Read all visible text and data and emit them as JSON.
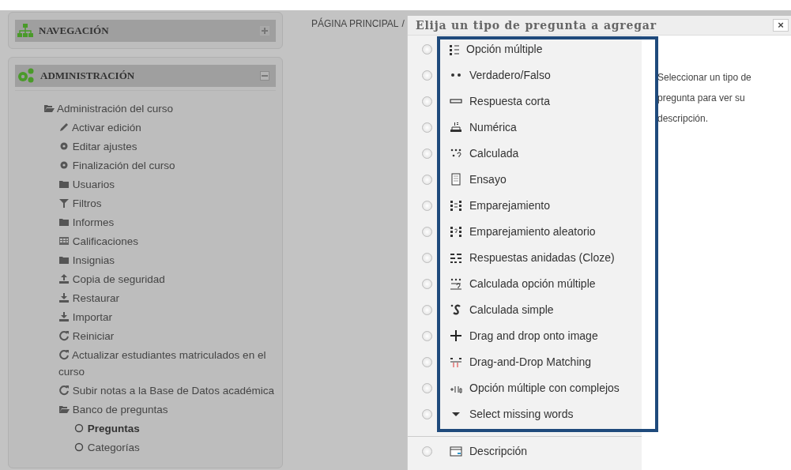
{
  "breadcrumb": {
    "home": "PÁGINA PRINCIPAL",
    "separator": "/"
  },
  "blocks": [
    {
      "title": "NAVEGACIÓN",
      "kind": "navigation",
      "expanded": false
    },
    {
      "title": "ADMINISTRACIÓN",
      "kind": "admin",
      "expanded": true,
      "items": [
        {
          "label": "Administración del curso",
          "kind": "folder-open",
          "selected": false,
          "children": [
            {
              "label": "Activar edición",
              "kind": "pencil",
              "selected": false
            },
            {
              "label": "Editar ajustes",
              "kind": "gear",
              "selected": false
            },
            {
              "label": "Finalización del curso",
              "kind": "gear",
              "selected": false
            },
            {
              "label": "Usuarios",
              "kind": "folder",
              "selected": false
            },
            {
              "label": "Filtros",
              "kind": "filter",
              "selected": false
            },
            {
              "label": "Informes",
              "kind": "folder",
              "selected": false
            },
            {
              "label": "Calificaciones",
              "kind": "table",
              "selected": false
            },
            {
              "label": "Insignias",
              "kind": "folder",
              "selected": false
            },
            {
              "label": "Copia de seguridad",
              "kind": "upload",
              "selected": false
            },
            {
              "label": "Restaurar",
              "kind": "download",
              "selected": false
            },
            {
              "label": "Importar",
              "kind": "download",
              "selected": false
            },
            {
              "label": "Reiniciar",
              "kind": "refresh",
              "selected": false
            },
            {
              "label": "Actualizar estudiantes matriculados en el curso",
              "kind": "refresh",
              "selected": false
            },
            {
              "label": "Subir notas a la Base de Datos académica",
              "kind": "refresh",
              "selected": false
            },
            {
              "label": "Banco de preguntas",
              "kind": "folder-open",
              "selected": false,
              "children": [
                {
                  "label": "Preguntas",
                  "kind": "circle",
                  "selected": true
                },
                {
                  "label": "Categorías",
                  "kind": "circle",
                  "selected": false
                }
              ]
            }
          ]
        }
      ]
    }
  ],
  "dialog": {
    "title": "Elija un tipo de pregunta a agregar",
    "close": "×",
    "options": [
      {
        "label": "Opción múltiple",
        "kind": "multichoice",
        "selected": false
      },
      {
        "label": "Verdadero/Falso",
        "kind": "truefalse",
        "selected": false
      },
      {
        "label": "Respuesta corta",
        "kind": "shortanswer",
        "selected": false
      },
      {
        "label": "Numérica",
        "kind": "numerical",
        "selected": false
      },
      {
        "label": "Calculada",
        "kind": "calculated",
        "selected": false
      },
      {
        "label": "Ensayo",
        "kind": "essay",
        "selected": false
      },
      {
        "label": "Emparejamiento",
        "kind": "match",
        "selected": false
      },
      {
        "label": "Emparejamiento aleatorio",
        "kind": "randommatch",
        "selected": false
      },
      {
        "label": "Respuestas anidadas (Cloze)",
        "kind": "cloze",
        "selected": false
      },
      {
        "label": "Calculada opción múltiple",
        "kind": "calcmulti",
        "selected": false
      },
      {
        "label": "Calculada simple",
        "kind": "calcsimple",
        "selected": false
      },
      {
        "label": "Drag and drop onto image",
        "kind": "ddimage",
        "selected": false
      },
      {
        "label": "Drag-and-Drop Matching",
        "kind": "ddmatch",
        "selected": false
      },
      {
        "label": "Opción múltiple con complejos",
        "kind": "complex",
        "selected": false
      },
      {
        "label": "Select missing words",
        "kind": "gapselect",
        "selected": false
      }
    ],
    "other_options": [
      {
        "label": "Descripción",
        "kind": "description",
        "selected": false
      }
    ],
    "help": "Seleccionar un tipo de pregunta para ver su descripción."
  }
}
